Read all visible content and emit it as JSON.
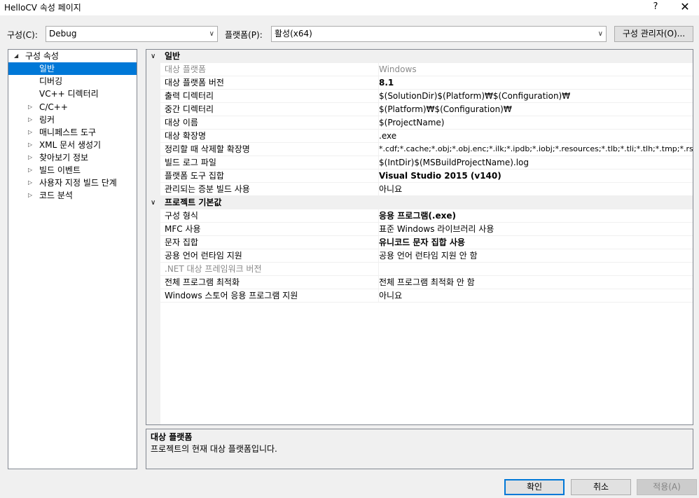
{
  "window": {
    "title": "HelloCV 속성 페이지",
    "help": "?",
    "close": "✕"
  },
  "toolbar": {
    "config_label": "구성(C):",
    "config_value": "Debug",
    "platform_label": "플랫폼(P):",
    "platform_value": "활성(x64)",
    "config_manager_button": "구성 관리자(O)..."
  },
  "tree": {
    "root": "구성 속성",
    "items": [
      "일반",
      "디버깅",
      "VC++ 디렉터리",
      "C/C++",
      "링커",
      "매니페스트 도구",
      "XML 문서 생성기",
      "찾아보기 정보",
      "빌드 이벤트",
      "사용자 지정 빌드 단계",
      "코드 분석"
    ],
    "selected": "일반"
  },
  "grid": {
    "categories": [
      {
        "name": "일반",
        "rows": [
          {
            "name": "대상 플랫폼",
            "value": "Windows",
            "disabled": true
          },
          {
            "name": "대상 플랫폼 버전",
            "value": "8.1",
            "bold": true
          },
          {
            "name": "출력 디렉터리",
            "value": "$(SolutionDir)$(Platform)₩$(Configuration)₩"
          },
          {
            "name": "중간 디렉터리",
            "value": "$(Platform)₩$(Configuration)₩"
          },
          {
            "name": "대상 이름",
            "value": "$(ProjectName)"
          },
          {
            "name": "대상 확장명",
            "value": ".exe"
          },
          {
            "name": "정리할 때 삭제할 확장명",
            "value": "*.cdf;*.cache;*.obj;*.obj.enc;*.ilk;*.ipdb;*.iobj;*.resources;*.tlb;*.tli;*.tlh;*.tmp;*.rsp;*.pg"
          },
          {
            "name": "빌드 로그 파일",
            "value": "$(IntDir)$(MSBuildProjectName).log"
          },
          {
            "name": "플랫폼 도구 집합",
            "value": "Visual Studio 2015 (v140)",
            "bold": true
          },
          {
            "name": "관리되는 증분 빌드 사용",
            "value": "아니요"
          }
        ]
      },
      {
        "name": "프로젝트 기본값",
        "rows": [
          {
            "name": "구성 형식",
            "value": "응용 프로그램(.exe)",
            "bold": true
          },
          {
            "name": "MFC 사용",
            "value": "표준 Windows 라이브러리 사용"
          },
          {
            "name": "문자 집합",
            "value": "유니코드 문자 집합 사용",
            "bold": true
          },
          {
            "name": "공용 언어 런타임 지원",
            "value": "공용 언어 런타임 지원 안 함"
          },
          {
            "name": ".NET 대상 프레임워크 버전",
            "value": "",
            "disabled": true
          },
          {
            "name": "전체 프로그램 최적화",
            "value": "전체 프로그램 최적화 안 함"
          },
          {
            "name": "Windows 스토어 응용 프로그램 지원",
            "value": "아니요"
          }
        ]
      }
    ]
  },
  "description": {
    "title": "대상 플랫폼",
    "text": "프로젝트의 현재 대상 플랫폼입니다."
  },
  "buttons": {
    "ok": "확인",
    "cancel": "취소",
    "apply": "적용(A)"
  }
}
